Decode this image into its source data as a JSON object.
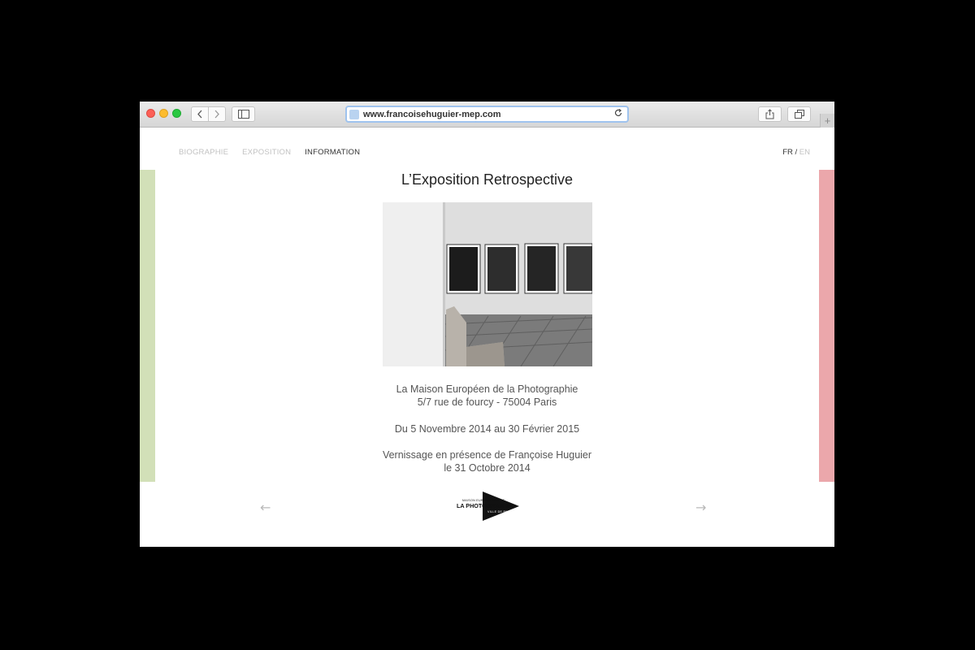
{
  "browser": {
    "url": "www.francoisehuguier-mep.com",
    "back_icon": "chevron-left-icon",
    "forward_icon": "chevron-right-icon",
    "reload_icon": "reload-icon",
    "new_tab_symbol": "+"
  },
  "nav": {
    "items": [
      {
        "label": "BIOGRAPHIE",
        "active": false
      },
      {
        "label": "EXPOSITION",
        "active": false
      },
      {
        "label": "INFORMATION",
        "active": true
      }
    ],
    "lang_active": "FR",
    "lang_separator": "/",
    "lang_inactive": "EN"
  },
  "main": {
    "title": "L’Exposition Retrospective",
    "venue_line1": "La Maison Européen de la Photographie",
    "venue_line2": "5/7 rue de fourcy - 75004 Paris",
    "dates": "Du 5 Novembre 2014 au 30 Février 2015",
    "opening_line1": "Vernissage en présence de Françoise Huguier",
    "opening_line2": "le 31 Octobre 2014"
  },
  "footer": {
    "prev_arrow": "←",
    "next_arrow": "→",
    "logo_line1": "MAISON EUROPÉENNE DE",
    "logo_line2": "LA PHOTOGRAPHIE",
    "logo_line3": "VILLE DE PARIS"
  },
  "colors": {
    "left_bar": "#d2e0b8",
    "right_bar": "#eba7ab",
    "url_focus": "#9fc3ee"
  }
}
